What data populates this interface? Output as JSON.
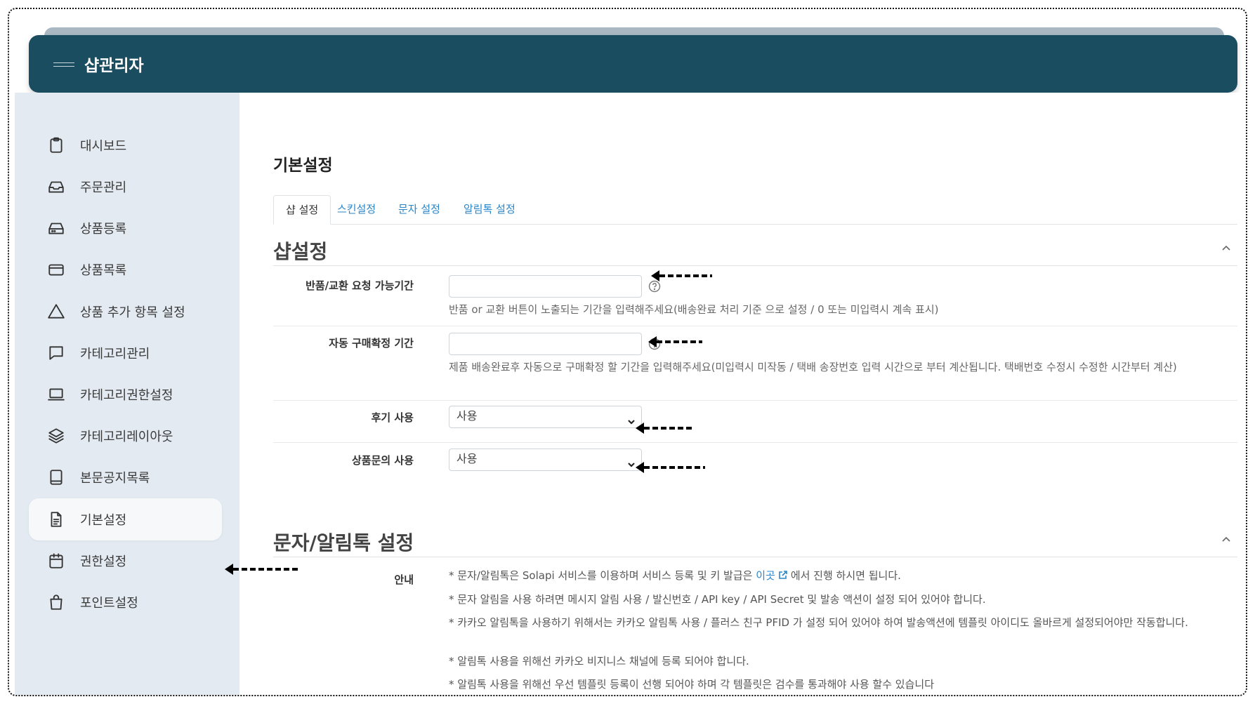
{
  "header": {
    "title": "샵관리자"
  },
  "sidebar": {
    "items": [
      {
        "label": "대시보드",
        "icon": "clipboard-icon"
      },
      {
        "label": "주문관리",
        "icon": "inbox-icon"
      },
      {
        "label": "상품등록",
        "icon": "drive-icon"
      },
      {
        "label": "상품목록",
        "icon": "card-icon"
      },
      {
        "label": "상품 추가 항목 설정",
        "icon": "triangle-icon"
      },
      {
        "label": "카테고리관리",
        "icon": "chat-icon"
      },
      {
        "label": "카테고리권한설정",
        "icon": "laptop-icon"
      },
      {
        "label": "카테고리레이아웃",
        "icon": "layers-icon"
      },
      {
        "label": "본문공지목록",
        "icon": "tablet-icon"
      },
      {
        "label": "기본설정",
        "icon": "document-icon",
        "active": true
      },
      {
        "label": "권한설정",
        "icon": "calendar-icon"
      },
      {
        "label": "포인트설정",
        "icon": "shopping-bag-icon"
      }
    ]
  },
  "main": {
    "page_title": "기본설정",
    "tabs": [
      {
        "label": "샵 설정",
        "active": true
      },
      {
        "label": "스킨설정"
      },
      {
        "label": "문자 설정"
      },
      {
        "label": "알림톡 설정"
      }
    ],
    "shop_section": {
      "title": "샵설정",
      "fields": {
        "return_period": {
          "label": "반품/교환 요청 가능기간",
          "value": "",
          "hint": "반품 or 교환 버튼이 노출되는 기간을 입력해주세요(배송완료 처리 기준 으로 설정 / 0 또는 미입력시 계속 표시)"
        },
        "auto_confirm": {
          "label": "자동 구매확정 기간",
          "value": "",
          "hint": "제품 배송완료후 자동으로 구매확정 할 기간을 입력해주세요(미입력시 미작동 / 택배 송장번호 입력 시간으로 부터 계산됩니다. 택배번호 수정시 수정한 시간부터 계산)"
        },
        "review": {
          "label": "후기 사용",
          "selected": "사용"
        },
        "inquiry": {
          "label": "상품문의 사용",
          "selected": "사용"
        }
      }
    },
    "sms_section": {
      "title": "문자/알림톡 설정",
      "notice_label": "안내",
      "notice_lines": {
        "line1_before": "* 문자/알림톡은 Solapi 서비스를 이용하며 서비스 등록 및 키 발급은",
        "line1_link": "이곳",
        "line1_after": "에서 진행 하시면 됩니다.",
        "line2": "* 문자 알림을 사용 하려면 메시지 알림 사용 / 발신번호 / API key / API Secret 및 발송 액션이 설정 되어 있어야 합니다.",
        "line3": "* 카카오 알림톡을 사용하기 위해서는 카카오 알림톡 사용 / 플러스 친구 PFID 가 설정 되어 있어야 하여 발송액션에 템플릿 아이디도 올바르게 설정되어야만 작동합니다.",
        "line4": "* 알림톡 사용을 위해선 카카오 비지니스 채널에 등록 되어야 합니다.",
        "line5": "* 알림톡 사용을 위해선 우선 템플릿 등록이 선행 되어야 하며 각 템플릿은 검수를 통과해야 사용 할수 있습니다"
      }
    }
  },
  "colors": {
    "header_bg": "#1a4d60",
    "sidebar_bg": "#e3eaf1",
    "link": "#2a86c9"
  }
}
